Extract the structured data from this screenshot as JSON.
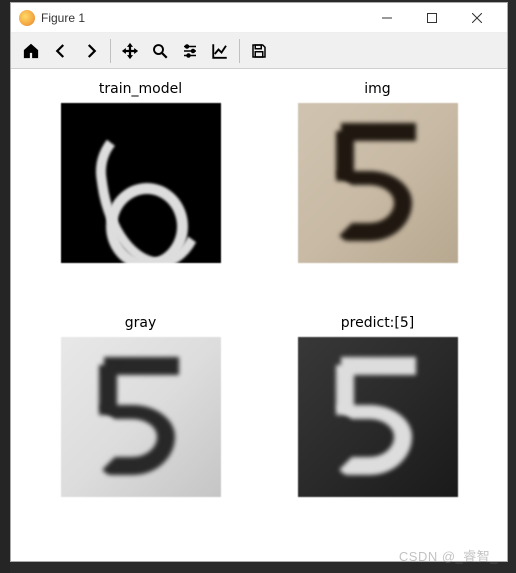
{
  "window": {
    "title": "Figure 1"
  },
  "toolbar": {
    "home": "home-icon",
    "back": "arrow-left-icon",
    "forward": "arrow-right-icon",
    "pan": "move-icon",
    "zoom": "zoom-icon",
    "configure": "sliders-icon",
    "axes": "chart-line-icon",
    "save": "save-icon"
  },
  "chart_data": [
    {
      "type": "image",
      "title": "train_model",
      "subject": "handwritten digit 6",
      "colormap": "binary (white-on-black)",
      "source": "MNIST-like 28x28"
    },
    {
      "type": "image",
      "title": "img",
      "subject": "handwritten digit 5",
      "colormap": "RGB (beige paper, dark ink)"
    },
    {
      "type": "image",
      "title": "gray",
      "subject": "handwritten digit 5",
      "colormap": "grayscale (light bg, dark ink)"
    },
    {
      "type": "image",
      "title": "predict:[5]",
      "subject": "handwritten digit 5",
      "colormap": "grayscale inverted (dark bg, light ink)",
      "predicted_label": 5
    }
  ],
  "plots": {
    "p0": {
      "title": "train_model"
    },
    "p1": {
      "title": "img"
    },
    "p2": {
      "title": "gray"
    },
    "p3": {
      "title": "predict:[5]"
    }
  },
  "watermark": "CSDN @_睿智_"
}
